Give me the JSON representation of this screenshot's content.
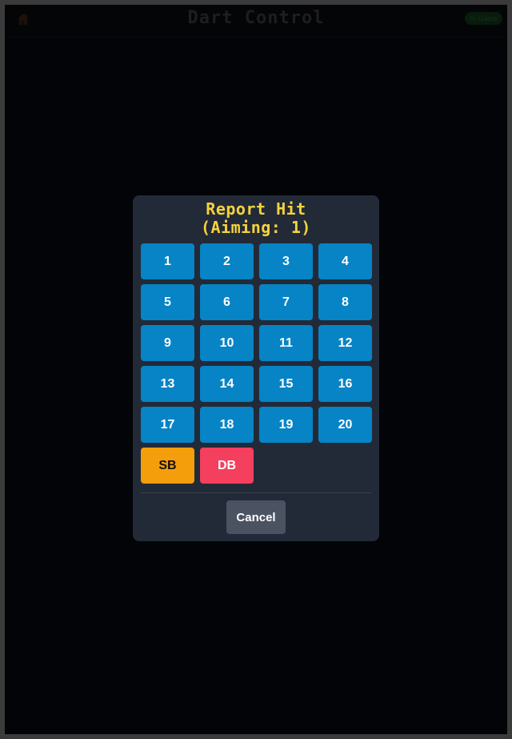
{
  "header": {
    "title": "Dart Control",
    "status": "In Game"
  },
  "modal": {
    "title_line1": "Report Hit",
    "title_line2": "(Aiming: 1)",
    "numbers": [
      "1",
      "2",
      "3",
      "4",
      "5",
      "6",
      "7",
      "8",
      "9",
      "10",
      "11",
      "12",
      "13",
      "14",
      "15",
      "16",
      "17",
      "18",
      "19",
      "20"
    ],
    "single_bull_label": "SB",
    "double_bull_label": "DB",
    "cancel_label": "Cancel"
  },
  "colors": {
    "number_button": "#0784c6",
    "single_bull": "#f59e0b",
    "double_bull": "#f43f5e",
    "title": "#f6d23c",
    "cancel": "#4b5262"
  },
  "icons": {
    "home": "home-icon"
  }
}
